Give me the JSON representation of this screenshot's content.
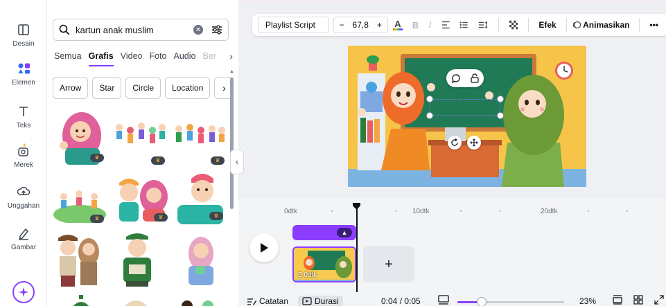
{
  "rail": {
    "items": [
      {
        "label": "Desain",
        "icon": "layout-icon"
      },
      {
        "label": "Elemen",
        "icon": "elements-icon",
        "active": true
      },
      {
        "label": "Teks",
        "icon": "text-icon"
      },
      {
        "label": "Merek",
        "icon": "brand-icon"
      },
      {
        "label": "Unggahan",
        "icon": "upload-icon"
      },
      {
        "label": "Gambar",
        "icon": "draw-icon"
      }
    ],
    "magic_icon": "sparkle-icon"
  },
  "panel": {
    "search": {
      "value": "kartun anak muslim"
    },
    "tabs": [
      "Semua",
      "Grafis",
      "Video",
      "Foto",
      "Audio",
      "Ber"
    ],
    "active_tab": "Grafis",
    "chips": [
      "Arrow",
      "Star",
      "Circle",
      "Location"
    ]
  },
  "toolbar": {
    "font": "Playlist Script",
    "minus": "−",
    "font_size": "67,8",
    "plus": "+",
    "text_color_glyph": "A",
    "bold": "B",
    "italic": "I",
    "effects": "Efek",
    "animate": "Animasikan",
    "more": "•••"
  },
  "timeline": {
    "ruler": [
      "0dtk",
      "10dtk",
      "20dtk"
    ],
    "clip_label": "5.0dtk",
    "add": "+"
  },
  "bottombar": {
    "notes": "Catatan",
    "duration": "Durasi",
    "time": "0:04 / 0:05",
    "zoom": "23%",
    "zoom_value": 0.23
  },
  "colors": {
    "accent": "#8b3dff",
    "canvas_wall": "#f7c94e",
    "board": "#1f7a55"
  }
}
